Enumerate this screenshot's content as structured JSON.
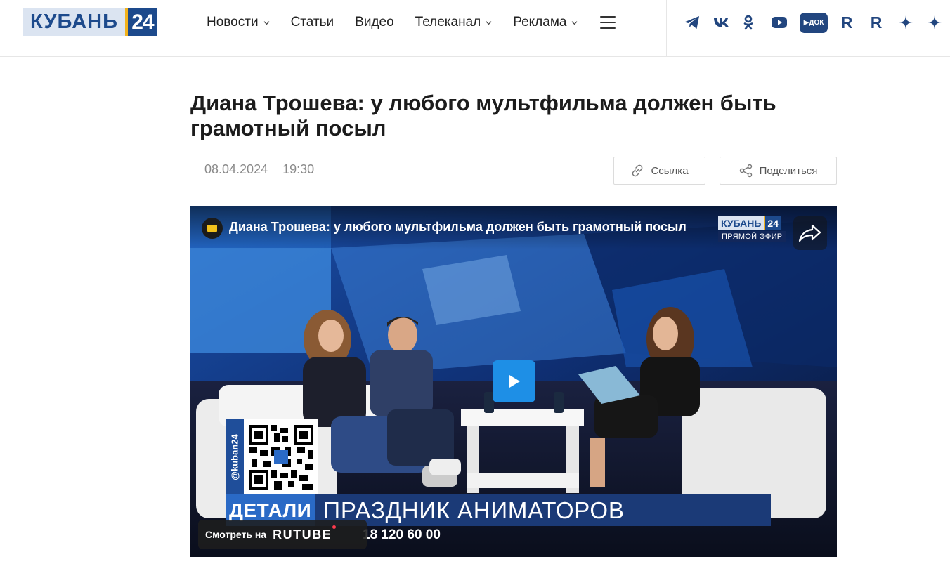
{
  "logo": {
    "word": "КУБАНЬ",
    "number": "24"
  },
  "nav": {
    "items": [
      {
        "label": "Новости",
        "has_dropdown": true
      },
      {
        "label": "Статьи",
        "has_dropdown": false
      },
      {
        "label": "Видео",
        "has_dropdown": false
      },
      {
        "label": "Телеканал",
        "has_dropdown": true
      },
      {
        "label": "Реклама",
        "has_dropdown": true
      }
    ],
    "menu_icon": "hamburger-icon"
  },
  "socials": [
    {
      "name": "telegram-icon"
    },
    {
      "name": "vk-icon"
    },
    {
      "name": "odnoklassniki-icon"
    },
    {
      "name": "youtube-icon"
    },
    {
      "name": "dok-icon",
      "label": "▶ДОК"
    },
    {
      "name": "rutube-icon",
      "label": "R"
    },
    {
      "name": "rustore-icon",
      "label": "R"
    },
    {
      "name": "zen-icon"
    },
    {
      "name": "dzen-icon"
    }
  ],
  "article": {
    "title": "Диана Трошева: у любого мультфильма должен быть грамотный посыл",
    "date": "08.04.2024",
    "time": "19:30",
    "link_button": "Ссылка",
    "share_button": "Поделиться"
  },
  "video": {
    "title": "Диана Трошева: у любого мультфильма должен быть грамотный посыл",
    "live_logo_word": "КУБАНЬ",
    "live_logo_num": "24",
    "live_text": "ПРЯМОЙ ЭФИР",
    "qr_handle": "@kuban24",
    "lower_label": "ДЕТАЛИ",
    "lower_text": "ПРАЗДНИК АНИМАТОРОВ",
    "phone": "18 120 60 00",
    "watch_on": "Смотреть на",
    "watch_brand": "RUTUBE"
  },
  "colors": {
    "brand_blue": "#1d4a8c",
    "brand_yellow": "#f2b21c",
    "play_button": "#1e8fe6",
    "lower_label_bg": "#2a6ac6",
    "lower_text_bg": "#1b3a77"
  }
}
